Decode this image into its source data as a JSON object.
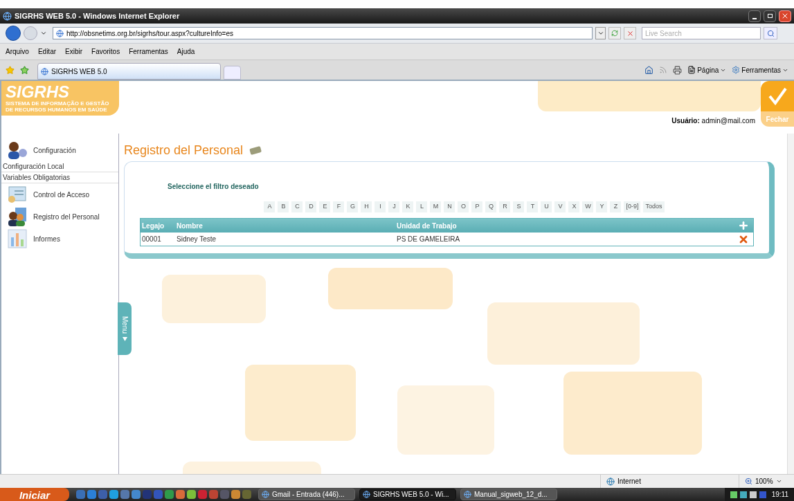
{
  "window": {
    "title": "SIGRHS WEB 5.0 - Windows Internet Explorer"
  },
  "address_bar": {
    "url": "http://obsnetims.org.br/sigrhs/tour.aspx?cultureInfo=es",
    "search_placeholder": "Live Search"
  },
  "menu_bar": [
    "Arquivo",
    "Editar",
    "Exibir",
    "Favoritos",
    "Ferramentas",
    "Ajuda"
  ],
  "tab": {
    "title": "SIGRHS WEB 5.0"
  },
  "command_bar": {
    "page": "Página",
    "tools": "Ferramentas"
  },
  "header": {
    "logo": "SIGRHS",
    "logo_subtitle": [
      "SISTEMA DE INFORMAÇÃO E GESTÃO",
      "DE RECURSOS HUMANOS EM SAÚDE"
    ],
    "user_label": "Usuário:",
    "user": "admin@mail.com",
    "close": "Fechar"
  },
  "sidebar": {
    "items": [
      {
        "kind": "main",
        "label": "Configuración"
      },
      {
        "kind": "sub",
        "label": "Configuración Local"
      },
      {
        "kind": "sub",
        "label": "Variables Obligatorias"
      },
      {
        "kind": "main",
        "label": "Control de Acceso"
      },
      {
        "kind": "main",
        "label": "Registro del Personal"
      },
      {
        "kind": "main",
        "label": "Informes"
      }
    ],
    "toggle": "Menu"
  },
  "page": {
    "title": "Registro del Personal",
    "filter_prompt": "Seleccione el filtro deseado",
    "filters": [
      "A",
      "B",
      "C",
      "D",
      "E",
      "F",
      "G",
      "H",
      "I",
      "J",
      "K",
      "L",
      "M",
      "N",
      "O",
      "P",
      "Q",
      "R",
      "S",
      "T",
      "U",
      "V",
      "X",
      "W",
      "Y",
      "Z",
      "[0-9]",
      "Todos"
    ],
    "table": {
      "columns": [
        "Legajo",
        "Nombre",
        "Unidad de Trabajo"
      ],
      "rows": [
        {
          "legajo": "00001",
          "nombre": "Sidney Teste",
          "unidad": "PS DE GAMELEIRA"
        }
      ]
    }
  },
  "status_bar": {
    "zone": "Internet",
    "zoom": "100%"
  },
  "taskbar": {
    "start": "Iniciar",
    "tasks": [
      {
        "label": "Gmail - Entrada (446)...",
        "selected": false
      },
      {
        "label": "SIGRHS WEB 5.0 - Wi...",
        "selected": true
      },
      {
        "label": "Manual_sigweb_12_d...",
        "selected": false
      }
    ],
    "clock": "19:11"
  }
}
